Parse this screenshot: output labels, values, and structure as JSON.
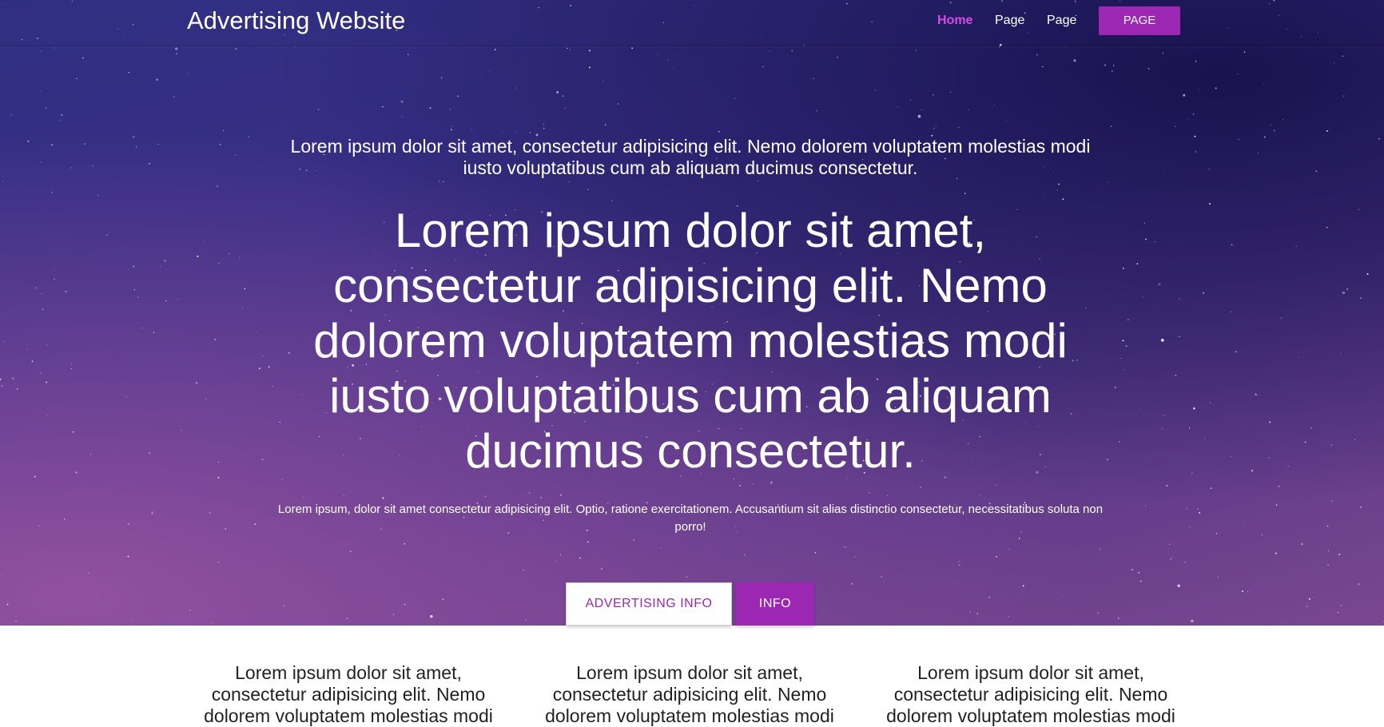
{
  "header": {
    "brand": "Advertising Website",
    "nav": [
      {
        "label": "Home",
        "active": true
      },
      {
        "label": "Page",
        "active": false
      },
      {
        "label": "Page",
        "active": false
      }
    ],
    "cta_label": "PAGE"
  },
  "hero": {
    "kicker": "Lorem ipsum dolor sit amet, consectetur adipisicing elit. Nemo dolorem voluptatem molestias modi iusto voluptatibus cum ab aliquam ducimus consectetur.",
    "headline": "Lorem ipsum dolor sit amet, consectetur adipisicing elit. Nemo dolorem voluptatem molestias modi iusto voluptatibus cum ab aliquam ducimus consectetur.",
    "lead": "Lorem ipsum, dolor sit amet consectetur adipisicing elit. Optio, ratione exercitationem. Accusantium sit alias distinctio consectetur, necessitatibus soluta non porro!",
    "primary_button": "ADVERTISING INFO",
    "secondary_button": "INFO"
  },
  "features": [
    {
      "text": "Lorem ipsum dolor sit amet, consectetur adipisicing elit. Nemo dolorem voluptatem molestias modi"
    },
    {
      "text": "Lorem ipsum dolor sit amet, consectetur adipisicing elit. Nemo dolorem voluptatem molestias modi"
    },
    {
      "text": "Lorem ipsum dolor sit amet, consectetur adipisicing elit. Nemo dolorem voluptatem molestias modi"
    }
  ],
  "colors": {
    "accent": "#9b27b3",
    "active_link": "#d64be8",
    "hero_top": "#2f2f82",
    "hero_bottom": "#7a4791"
  }
}
